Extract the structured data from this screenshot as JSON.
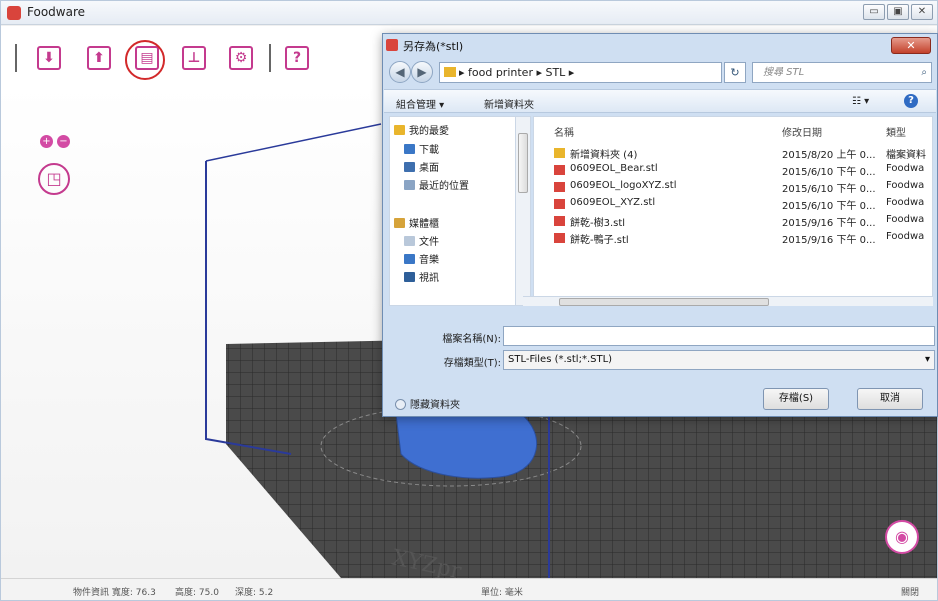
{
  "app": {
    "title": "Foodware",
    "window_buttons": [
      "▭",
      "▣",
      "✕"
    ]
  },
  "toolbar": {
    "import_glyph": "⬇",
    "export_glyph": "⬆",
    "save_glyph": "▤",
    "model_glyph": "⊥",
    "settings_glyph": "⚙",
    "help_glyph": "?"
  },
  "view": {
    "zoom_in": "+",
    "zoom_out": "−",
    "cube_glyph": "◳",
    "camera_glyph": "◉",
    "watermark": "XYZpr"
  },
  "statusbar": {
    "object_info": "物件資訊 寬度: 76.3",
    "height": "高度: 75.0",
    "depth": "深度: 5.2",
    "unit": "單位: 毫米",
    "close": "關閉"
  },
  "dialog": {
    "title": "另存為(*stl)",
    "close": "✕",
    "breadcrumb": "▸ food printer ▸ STL ▸",
    "refresh": "↻",
    "search_placeholder": "搜尋 STL",
    "search_icon": "⌕",
    "organize": "組合管理 ▾",
    "new_folder": "新增資料夾",
    "view_toggle": "☷ ▾",
    "help": "?",
    "nav": [
      {
        "label": "我的最愛",
        "color": "#e9b52c"
      },
      {
        "label": "下載",
        "color": "#3a77c6"
      },
      {
        "label": "桌面",
        "color": "#3e6fae"
      },
      {
        "label": "最近的位置",
        "color": "#8aa4c4"
      },
      {
        "label": "媒體櫃",
        "color": "#d6a33a"
      },
      {
        "label": "文件",
        "color": "#b9c8da"
      },
      {
        "label": "音樂",
        "color": "#3a77c6"
      },
      {
        "label": "視訊",
        "color": "#2e5f99"
      }
    ],
    "headers": {
      "name": "名稱",
      "date": "修改日期",
      "type": "類型"
    },
    "files": [
      {
        "name": "新增資料夾 (4)",
        "date": "2015/8/20 上午 0...",
        "type": "檔案資料",
        "icon_color": "#e9b52c"
      },
      {
        "name": "0609EOL_Bear.stl",
        "date": "2015/6/10 下午 0...",
        "type": "Foodwa",
        "icon_color": "#d9443c"
      },
      {
        "name": "0609EOL_logoXYZ.stl",
        "date": "2015/6/10 下午 0...",
        "type": "Foodwa",
        "icon_color": "#d9443c"
      },
      {
        "name": "0609EOL_XYZ.stl",
        "date": "2015/6/10 下午 0...",
        "type": "Foodwa",
        "icon_color": "#d9443c"
      },
      {
        "name": "餅乾-樹3.stl",
        "date": "2015/9/16 下午 0...",
        "type": "Foodwa",
        "icon_color": "#d9443c"
      },
      {
        "name": "餅乾-鴨子.stl",
        "date": "2015/9/16 下午 0...",
        "type": "Foodwa",
        "icon_color": "#d9443c"
      }
    ],
    "filename_label": "檔案名稱(N):",
    "filename_value": "",
    "filetype_label": "存檔類型(T):",
    "filetype_value": "STL-Files (*.stl;*.STL)",
    "hide_folders": "隱藏資料夾",
    "save": "存檔(S)",
    "cancel": "取消"
  }
}
